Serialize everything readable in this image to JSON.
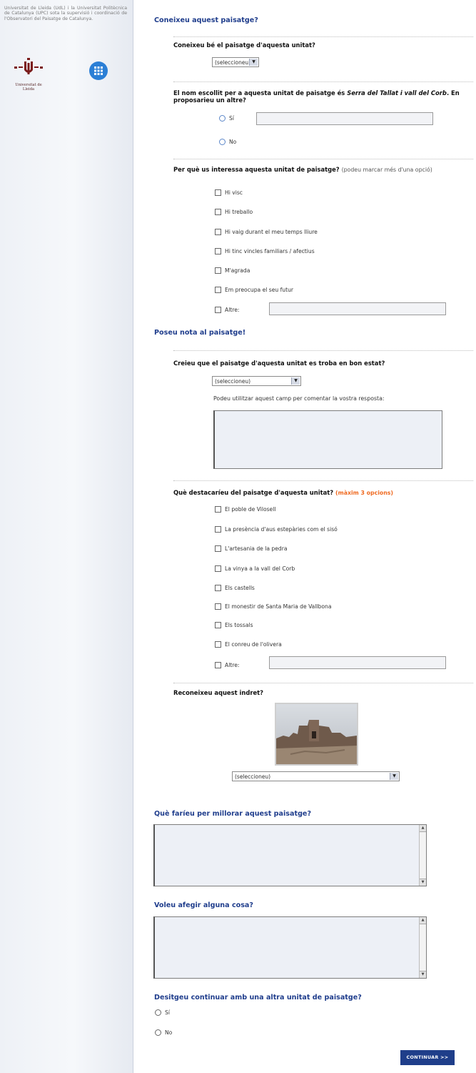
{
  "sidebar": {
    "intro": "Universitat de Lleida (UdL) i la Universitat Politècnica de Catalunya (UPC) sota la supervisió i coordinació de l'Observatori del Paisatge de Catalunya.",
    "udl_caption": "Universitat de Lleida"
  },
  "sections": {
    "know": "Coneixeu aquest paisatge?",
    "rate": "Poseu nota al paisatge!",
    "improve": "Què faríeu per millorar aquest paisatge?",
    "add": "Voleu afegir alguna cosa?",
    "continue_q": "Desitgeu continuar amb una altra unitat de paisatge?"
  },
  "q_know_well": {
    "label": "Coneixeu bé el paisatge d'aquesta unitat?",
    "select": "(seleccioneu)"
  },
  "q_name": {
    "label_pre": "El nom escollit per a aquesta unitat de paisatge és ",
    "label_em": "Serra del Tallat i vall del Corb",
    "label_post": ". En proposarieu un altre?",
    "yes": "Sí",
    "no": "No"
  },
  "q_interest": {
    "label": "Per què us interessa aquesta unitat de paisatge?",
    "note": "(podeu marcar més d'una opció)",
    "options": [
      "Hi visc",
      "Hi treballo",
      "Hi vaig durant el meu temps lliure",
      "Hi tinc vincles familiars / afectius",
      "M'agrada",
      "Em preocupa el seu futur",
      "Altre:"
    ]
  },
  "q_state": {
    "label": "Creieu que el paisatge d'aquesta unitat es troba en bon estat?",
    "select": "(seleccioneu)",
    "comment_hint": "Podeu utilitzar aquest camp per comentar la vostra resposta:"
  },
  "q_highlight": {
    "label": "Què destacaríeu del paisatge d'aquesta unitat?",
    "warn": "(màxim 3 opcions)",
    "options": [
      "El poble de Vilosell",
      "La presència d'aus estepàries com el sisó",
      "L'artesania de la pedra",
      "La vinya a la vall del Corb",
      "Els castells",
      "El monestir de Santa Maria de Vallbona",
      "Els tossals",
      "El conreu de l'olivera",
      "Altre:"
    ]
  },
  "q_place": {
    "label": "Reconeixeu aquest indret?",
    "select": "(seleccioneu)"
  },
  "q_continue": {
    "yes": "Sí",
    "no": "No"
  },
  "buttons": {
    "continue": "CONTINUAR >>"
  }
}
